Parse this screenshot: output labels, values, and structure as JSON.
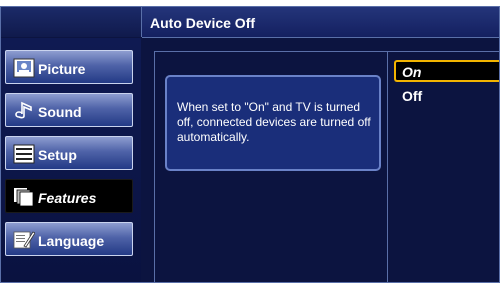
{
  "header": {
    "title": "Auto Device Off"
  },
  "sidebar": {
    "items": [
      {
        "label": "Picture",
        "icon": "picture-icon",
        "active": false
      },
      {
        "label": "Sound",
        "icon": "music-note-icon",
        "active": false
      },
      {
        "label": "Setup",
        "icon": "list-icon",
        "active": false
      },
      {
        "label": "Features",
        "icon": "stack-icon",
        "active": true
      },
      {
        "label": "Language",
        "icon": "language-icon",
        "active": false
      }
    ]
  },
  "description": {
    "text": "When set to \"On\" and TV is turned off, connected devices are turned off automatically."
  },
  "options": {
    "items": [
      {
        "label": "On",
        "selected": true
      },
      {
        "label": "Off",
        "selected": false
      }
    ]
  },
  "colors": {
    "background": "#0c1440",
    "highlight_border": "#f2b400",
    "button_blue": "#4f63a8"
  }
}
